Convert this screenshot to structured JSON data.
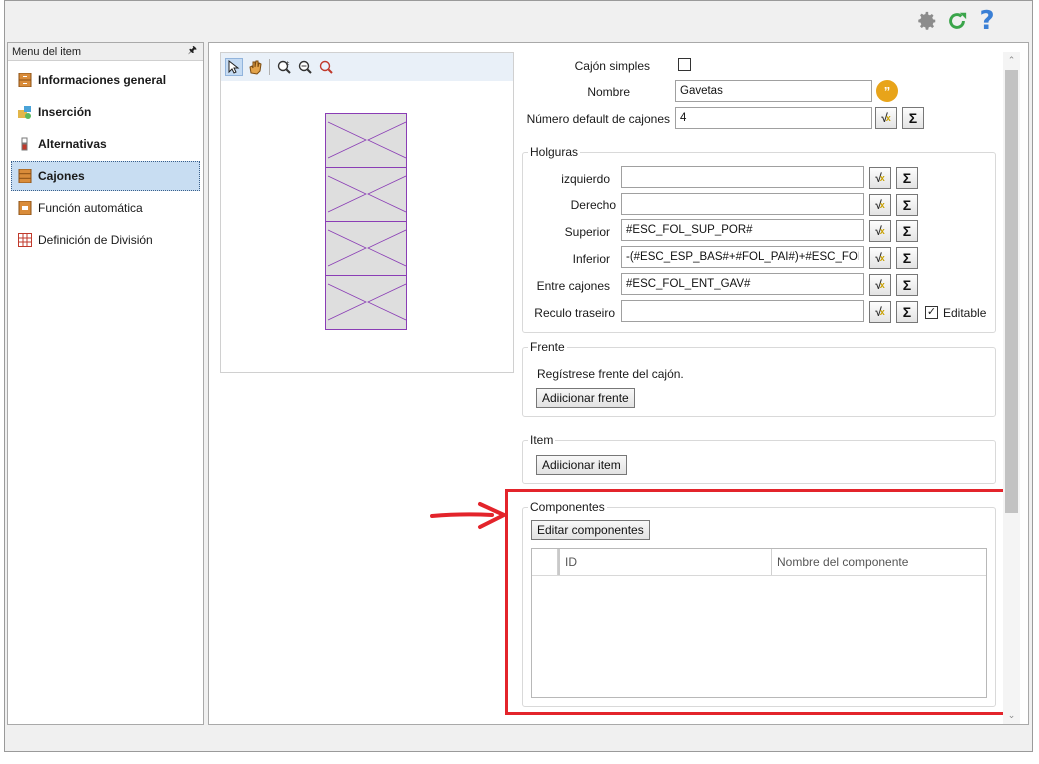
{
  "sidebar": {
    "header": "Menu del item",
    "items": [
      {
        "label": "Informaciones general",
        "icon": "drawer-cabinet-icon"
      },
      {
        "label": "Inserción",
        "icon": "insert-puzzle-icon"
      },
      {
        "label": "Alternativas",
        "icon": "alternatives-icon"
      },
      {
        "label": "Cajones",
        "icon": "drawers-icon"
      },
      {
        "label": "Función automática",
        "icon": "automatic-function-icon"
      },
      {
        "label": "Definición de División",
        "icon": "division-grid-icon"
      }
    ]
  },
  "form": {
    "cajon_simples_label": "Cajón simples",
    "nombre_label": "Nombre",
    "nombre_value": "Gavetas",
    "numero_label": "Número default de cajones",
    "numero_value": "4"
  },
  "holguras": {
    "title": "Holguras",
    "izquierdo_label": "izquierdo",
    "izquierdo_value": "",
    "derecho_label": "Derecho",
    "derecho_value": "",
    "superior_label": "Superior",
    "superior_value": "#ESC_FOL_SUP_POR#",
    "inferior_label": "Inferior",
    "inferior_value": "-(#ESC_ESP_BAS#+#FOL_PAI#)+#ESC_FOL_",
    "entre_label": "Entre cajones",
    "entre_value": "#ESC_FOL_ENT_GAV#",
    "reculo_label": "Reculo traseiro",
    "reculo_value": "",
    "editable_label": "Editable"
  },
  "frente": {
    "title": "Frente",
    "text": "Regístrese frente del cajón.",
    "button": "Adiicionar frente"
  },
  "item": {
    "title": "Item",
    "button": "Adiicionar item"
  },
  "componentes": {
    "title": "Componentes",
    "button": "Editar componentes",
    "columns": [
      "ID",
      "Nombre del componente"
    ]
  },
  "colors": {
    "highlight": "#e3242b",
    "selected_bg": "#c8ddf2",
    "drawer_outline": "#8a3db5"
  }
}
